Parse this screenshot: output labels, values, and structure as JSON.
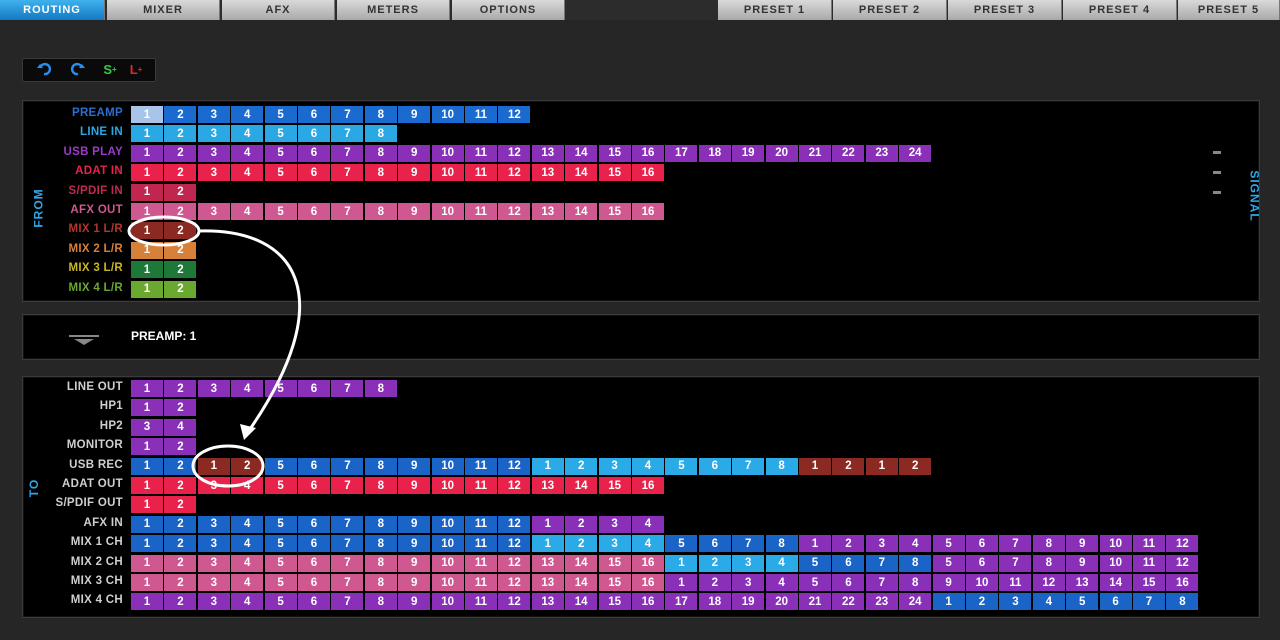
{
  "tabs": [
    {
      "label": "ROUTING",
      "active": true
    },
    {
      "label": "MIXER"
    },
    {
      "label": "AFX"
    },
    {
      "label": "METERS"
    },
    {
      "label": "OPTIONS"
    }
  ],
  "presets": [
    "PRESET 1",
    "PRESET 2",
    "PRESET 3",
    "PRESET 4",
    "PRESET 5"
  ],
  "toolbar": {
    "undo_icon": "undo-arrow-icon",
    "redo_icon": "redo-arrow-icon",
    "s_label": "S",
    "l_label": "L"
  },
  "colors": {
    "preamp": "#1a6ad0",
    "line_in": "#2aa8e4",
    "usb_play": "#8a2fb8",
    "adat": "#e8224a",
    "spdif": "#c0264e",
    "afx_out": "#d05890",
    "mix1": "#8a2a22",
    "mix2": "#d6803a",
    "mix3": "#1e7838",
    "mix4": "#6aa830",
    "blue_dark": "#1a64c8",
    "blue_light": "#2aaae6",
    "purple": "#8a2fb8",
    "red": "#e8224a",
    "pink": "#d05890"
  },
  "from": {
    "side_label": "FROM",
    "signal_label": "SIGNAL",
    "rows": [
      {
        "label": "PREAMP",
        "label_color": "#2a6ed0",
        "segments": [
          {
            "color": "#1a6ad0",
            "values": [
              "1",
              "2",
              "3",
              "4",
              "5",
              "6",
              "7",
              "8",
              "9",
              "10",
              "11",
              "12"
            ]
          }
        ],
        "selected_first": true
      },
      {
        "label": "LINE IN",
        "label_color": "#2aa8e4",
        "segments": [
          {
            "color": "#2aa8e4",
            "values": [
              "1",
              "2",
              "3",
              "4",
              "5",
              "6",
              "7",
              "8"
            ]
          }
        ]
      },
      {
        "label": "USB PLAY",
        "label_color": "#9a3ac8",
        "segments": [
          {
            "color": "#8a2fb8",
            "values": [
              "1",
              "2",
              "3",
              "4",
              "5",
              "6",
              "7",
              "8",
              "9",
              "10",
              "11",
              "12",
              "13",
              "14",
              "15",
              "16",
              "17",
              "18",
              "19",
              "20",
              "21",
              "22",
              "23",
              "24"
            ]
          }
        ]
      },
      {
        "label": "ADAT IN",
        "label_color": "#e8224a",
        "segments": [
          {
            "color": "#e8224a",
            "values": [
              "1",
              "2",
              "3",
              "4",
              "5",
              "6",
              "7",
              "8",
              "9",
              "10",
              "11",
              "12",
              "13",
              "14",
              "15",
              "16"
            ]
          }
        ]
      },
      {
        "label": "S/PDIF IN",
        "label_color": "#c02a52",
        "segments": [
          {
            "color": "#c0264e",
            "values": [
              "1",
              "2"
            ]
          }
        ]
      },
      {
        "label": "AFX OUT",
        "label_color": "#d05890",
        "segments": [
          {
            "color": "#d05890",
            "values": [
              "1",
              "2",
              "3",
              "4",
              "5",
              "6",
              "7",
              "8",
              "9",
              "10",
              "11",
              "12",
              "13",
              "14",
              "15",
              "16"
            ]
          }
        ]
      },
      {
        "label": "MIX 1 L/R",
        "label_color": "#b0382a",
        "segments": [
          {
            "color": "#8a2a22",
            "values": [
              "1",
              "2"
            ]
          }
        ]
      },
      {
        "label": "MIX 2 L/R",
        "label_color": "#d6803a",
        "segments": [
          {
            "color": "#d6803a",
            "values": [
              "1",
              "2"
            ]
          }
        ]
      },
      {
        "label": "MIX 3 L/R",
        "label_color": "#c8b820",
        "segments": [
          {
            "color": "#1e7838",
            "values": [
              "1",
              "2"
            ]
          }
        ]
      },
      {
        "label": "MIX 4 L/R",
        "label_color": "#6aa830",
        "segments": [
          {
            "color": "#6aa830",
            "values": [
              "1",
              "2"
            ]
          }
        ]
      }
    ]
  },
  "selection": {
    "label": "PREAMP: 1"
  },
  "to": {
    "side_label": "TO",
    "rows": [
      {
        "label": "LINE OUT",
        "segments": [
          {
            "color": "#8a2fb8",
            "values": [
              "1",
              "2",
              "3",
              "4",
              "5",
              "6",
              "7",
              "8"
            ]
          }
        ]
      },
      {
        "label": "HP1",
        "segments": [
          {
            "color": "#8a2fb8",
            "values": [
              "1",
              "2"
            ]
          }
        ]
      },
      {
        "label": "HP2",
        "segments": [
          {
            "color": "#8a2fb8",
            "values": [
              "3",
              "4"
            ]
          }
        ]
      },
      {
        "label": "MONITOR",
        "segments": [
          {
            "color": "#8a2fb8",
            "values": [
              "1",
              "2"
            ]
          }
        ]
      },
      {
        "label": "USB REC",
        "segments": [
          {
            "color": "#1a64c8",
            "values": [
              "1",
              "2"
            ]
          },
          {
            "color": "#8a2a22",
            "values": [
              "1",
              "2"
            ]
          },
          {
            "color": "#1a64c8",
            "values": [
              "5",
              "6",
              "7",
              "8",
              "9",
              "10",
              "11",
              "12"
            ]
          },
          {
            "color": "#2aaae6",
            "values": [
              "1",
              "2",
              "3",
              "4",
              "5",
              "6",
              "7",
              "8"
            ]
          },
          {
            "color": "#8a2a22",
            "values": [
              "1",
              "2",
              "1",
              "2"
            ]
          }
        ]
      },
      {
        "label": "ADAT OUT",
        "segments": [
          {
            "color": "#e8224a",
            "values": [
              "1",
              "2",
              "3",
              "4",
              "5",
              "6",
              "7",
              "8",
              "9",
              "10",
              "11",
              "12",
              "13",
              "14",
              "15",
              "16"
            ]
          }
        ]
      },
      {
        "label": "S/PDIF OUT",
        "segments": [
          {
            "color": "#e8224a",
            "values": [
              "1",
              "2"
            ]
          }
        ]
      },
      {
        "label": "AFX IN",
        "segments": [
          {
            "color": "#1a64c8",
            "values": [
              "1",
              "2",
              "3",
              "4",
              "5",
              "6",
              "7",
              "8",
              "9",
              "10",
              "11",
              "12"
            ]
          },
          {
            "color": "#8a2fb8",
            "values": [
              "1",
              "2",
              "3",
              "4"
            ]
          }
        ]
      },
      {
        "label": "MIX 1 CH",
        "segments": [
          {
            "color": "#1a64c8",
            "values": [
              "1",
              "2",
              "3",
              "4",
              "5",
              "6",
              "7",
              "8",
              "9",
              "10",
              "11",
              "12"
            ]
          },
          {
            "color": "#2aaae6",
            "values": [
              "1",
              "2",
              "3",
              "4"
            ]
          },
          {
            "color": "#1a64c8",
            "values": [
              "5",
              "6",
              "7",
              "8"
            ]
          },
          {
            "color": "#8a2fb8",
            "values": [
              "1",
              "2",
              "3",
              "4",
              "5",
              "6",
              "7",
              "8",
              "9",
              "10",
              "11",
              "12"
            ]
          }
        ]
      },
      {
        "label": "MIX 2 CH",
        "segments": [
          {
            "color": "#d05890",
            "values": [
              "1",
              "2",
              "3",
              "4",
              "5",
              "6",
              "7",
              "8",
              "9",
              "10",
              "11",
              "12",
              "13",
              "14",
              "15",
              "16"
            ]
          },
          {
            "color": "#2aaae6",
            "values": [
              "1",
              "2",
              "3",
              "4"
            ]
          },
          {
            "color": "#1a64c8",
            "values": [
              "5",
              "6",
              "7",
              "8"
            ]
          },
          {
            "color": "#8a2fb8",
            "values": [
              "5",
              "6",
              "7",
              "8",
              "9",
              "10",
              "11",
              "12"
            ]
          }
        ]
      },
      {
        "label": "MIX 3 CH",
        "segments": [
          {
            "color": "#d05890",
            "values": [
              "1",
              "2",
              "3",
              "4",
              "5",
              "6",
              "7",
              "8",
              "9",
              "10",
              "11",
              "12",
              "13",
              "14",
              "15",
              "16"
            ]
          },
          {
            "color": "#8a2fb8",
            "values": [
              "1",
              "2",
              "3",
              "4",
              "5",
              "6",
              "7",
              "8",
              "9",
              "10",
              "11",
              "12",
              "13",
              "14",
              "15",
              "16"
            ]
          }
        ]
      },
      {
        "label": "MIX 4 CH",
        "segments": [
          {
            "color": "#8a2fb8",
            "values": [
              "1",
              "2",
              "3",
              "4",
              "5",
              "6",
              "7",
              "8",
              "9",
              "10",
              "11",
              "12",
              "13",
              "14",
              "15",
              "16",
              "17",
              "18",
              "19",
              "20",
              "21",
              "22",
              "23",
              "24"
            ]
          },
          {
            "color": "#1a64c8",
            "values": [
              "1",
              "2",
              "3",
              "4",
              "5",
              "6",
              "7",
              "8"
            ]
          }
        ]
      }
    ]
  }
}
